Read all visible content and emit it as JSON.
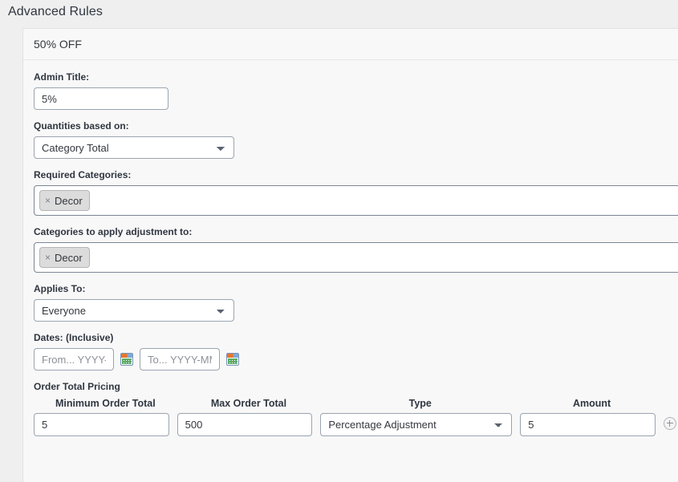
{
  "page": {
    "title": "Advanced Rules"
  },
  "rule_panel": {
    "header_title": "50% OFF",
    "admin_title": {
      "label": "Admin Title:",
      "value": "5%"
    },
    "quantities_based_on": {
      "label": "Quantities based on:",
      "value": "Category Total",
      "options": [
        "Category Total"
      ]
    },
    "required_categories": {
      "label": "Required Categories:",
      "tags": [
        {
          "remove_icon": "×",
          "label": "Decor"
        }
      ]
    },
    "categories_to_apply": {
      "label": "Categories to apply adjustment to:",
      "tags": [
        {
          "remove_icon": "×",
          "label": "Decor"
        }
      ]
    },
    "applies_to": {
      "label": "Applies To:",
      "value": "Everyone",
      "options": [
        "Everyone"
      ]
    },
    "dates": {
      "label": "Dates: (Inclusive)",
      "from": {
        "value": "",
        "placeholder": "From... YYYY-MM-DD"
      },
      "to": {
        "value": "",
        "placeholder": "To... YYYY-MM-DD"
      },
      "calendar_icon": "calendar-icon"
    },
    "order_total_pricing": {
      "section_title": "Order Total Pricing",
      "columns": [
        "Minimum Order Total",
        "Max Order Total",
        "Type",
        "Amount"
      ],
      "rows": [
        {
          "minimum_order_total": "5",
          "max_order_total": "500",
          "type": "Percentage Adjustment",
          "type_options": [
            "Percentage Adjustment"
          ],
          "amount": "5"
        }
      ],
      "add_row_icon": "plus-circle-icon"
    }
  },
  "colors": {
    "page_background": "#efefef",
    "panel_background": "#f8f8f8",
    "panel_border": "#e2e2e2",
    "text_primary": "#2f3640",
    "input_border": "#9aa4af",
    "tag_background": "#dcdcdc",
    "calendar_icon_accent": "#e8762c"
  }
}
